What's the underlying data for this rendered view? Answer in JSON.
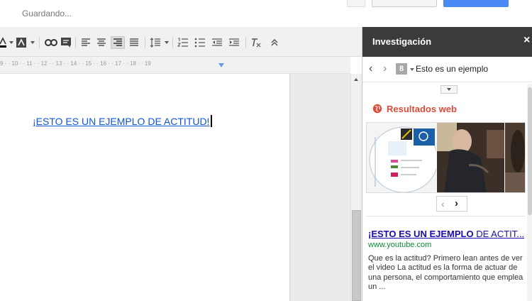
{
  "header": {
    "status": "Guardando..."
  },
  "ruler": {
    "marks": "9 ·  · 10 ·  · 11 ·  · 12 ·  · 13 ·  · 14 ·  · 15 ·  · 16 ·  · 17 ·  · 18 ·  · 19"
  },
  "document": {
    "text": "¡ESTO ES UN EJEMPLO DE ACTITUD!"
  },
  "research": {
    "title": "Investigación",
    "close_label": "×",
    "back_label": "‹",
    "forward_label": "›",
    "engine_icon_label": "8",
    "query": "Esto es un ejemplo",
    "section_title": "Resultados web",
    "pager_prev": "‹",
    "pager_next": "›",
    "result": {
      "title_bold": "¡ESTO ES UN EJEMPLO",
      "title_rest": " DE ACTIT...",
      "url": "www.youtube.com",
      "snippet": "Que es la actitud? Primero lean antes de ver el video La actitud es la forma de actuar de una persona, el comportamiento que emplea un ..."
    }
  },
  "colors": {
    "panel_header": "#3b3b3b",
    "link": "#1155cc",
    "web_results_title": "#dd4b39",
    "result_url": "#0b8a33",
    "primary_button": "#4a8af4"
  },
  "icons": {
    "toolbar": [
      "text-color-icon",
      "highlight-color-icon",
      "link-icon",
      "comment-icon",
      "align-left-icon",
      "align-center-icon",
      "align-right-icon",
      "justify-icon",
      "line-spacing-icon",
      "numbered-list-icon",
      "bulleted-list-icon",
      "decrease-indent-icon",
      "increase-indent-icon",
      "clear-formatting-icon",
      "collapse-toolbar-icon"
    ]
  }
}
